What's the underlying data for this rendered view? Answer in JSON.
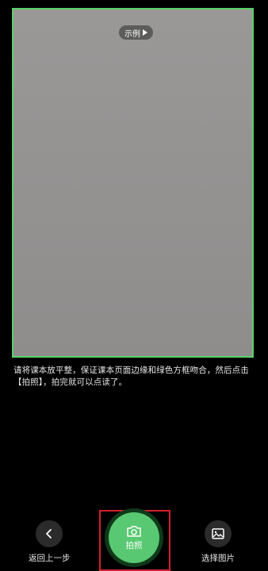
{
  "viewfinder": {
    "sample_label": "示例"
  },
  "instruction": "请将课本放平整，保证课本页面边缘和绿色方框吻合，然后点击【拍照】，拍完就可以点读了。",
  "controls": {
    "back_label": "返回上一步",
    "shutter_label": "拍照",
    "gallery_label": "选择图片"
  },
  "colors": {
    "frame": "#5ad06a",
    "shutter": "#59c872",
    "highlight": "#d51f2e"
  }
}
